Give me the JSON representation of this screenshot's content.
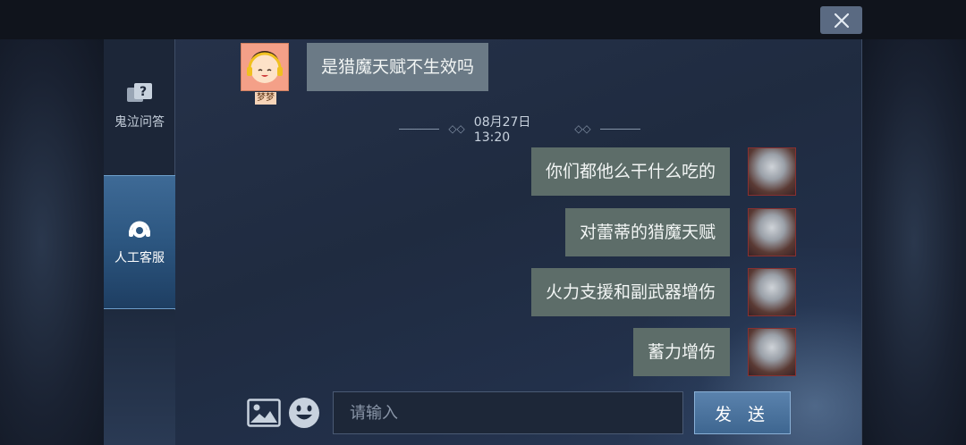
{
  "window": {
    "close_icon": "close-icon"
  },
  "sidebar": {
    "items": [
      {
        "label": "鬼泣问答",
        "icon": "question-chat-icon",
        "active": false
      },
      {
        "label": "人工客服",
        "icon": "headset-icon",
        "active": true
      }
    ]
  },
  "chat": {
    "incoming": {
      "avatar_name": "梦梦",
      "text": "是猎魔天赋不生效吗"
    },
    "timestamp": "08月27日 13:20",
    "outgoing": [
      {
        "text": "你们都他么干什么吃的"
      },
      {
        "text": "对蕾蒂的猎魔天赋"
      },
      {
        "text": "火力支援和副武器增伤"
      },
      {
        "text": "蓄力增伤"
      }
    ]
  },
  "composer": {
    "image_icon": "image-icon",
    "emoji_icon": "emoji-icon",
    "placeholder": "请输入",
    "send_label": "发 送"
  },
  "colors": {
    "accent": "#3e6a96",
    "bubble_outgoing": "#5d6d69",
    "bubble_incoming": "#6b7a86"
  }
}
